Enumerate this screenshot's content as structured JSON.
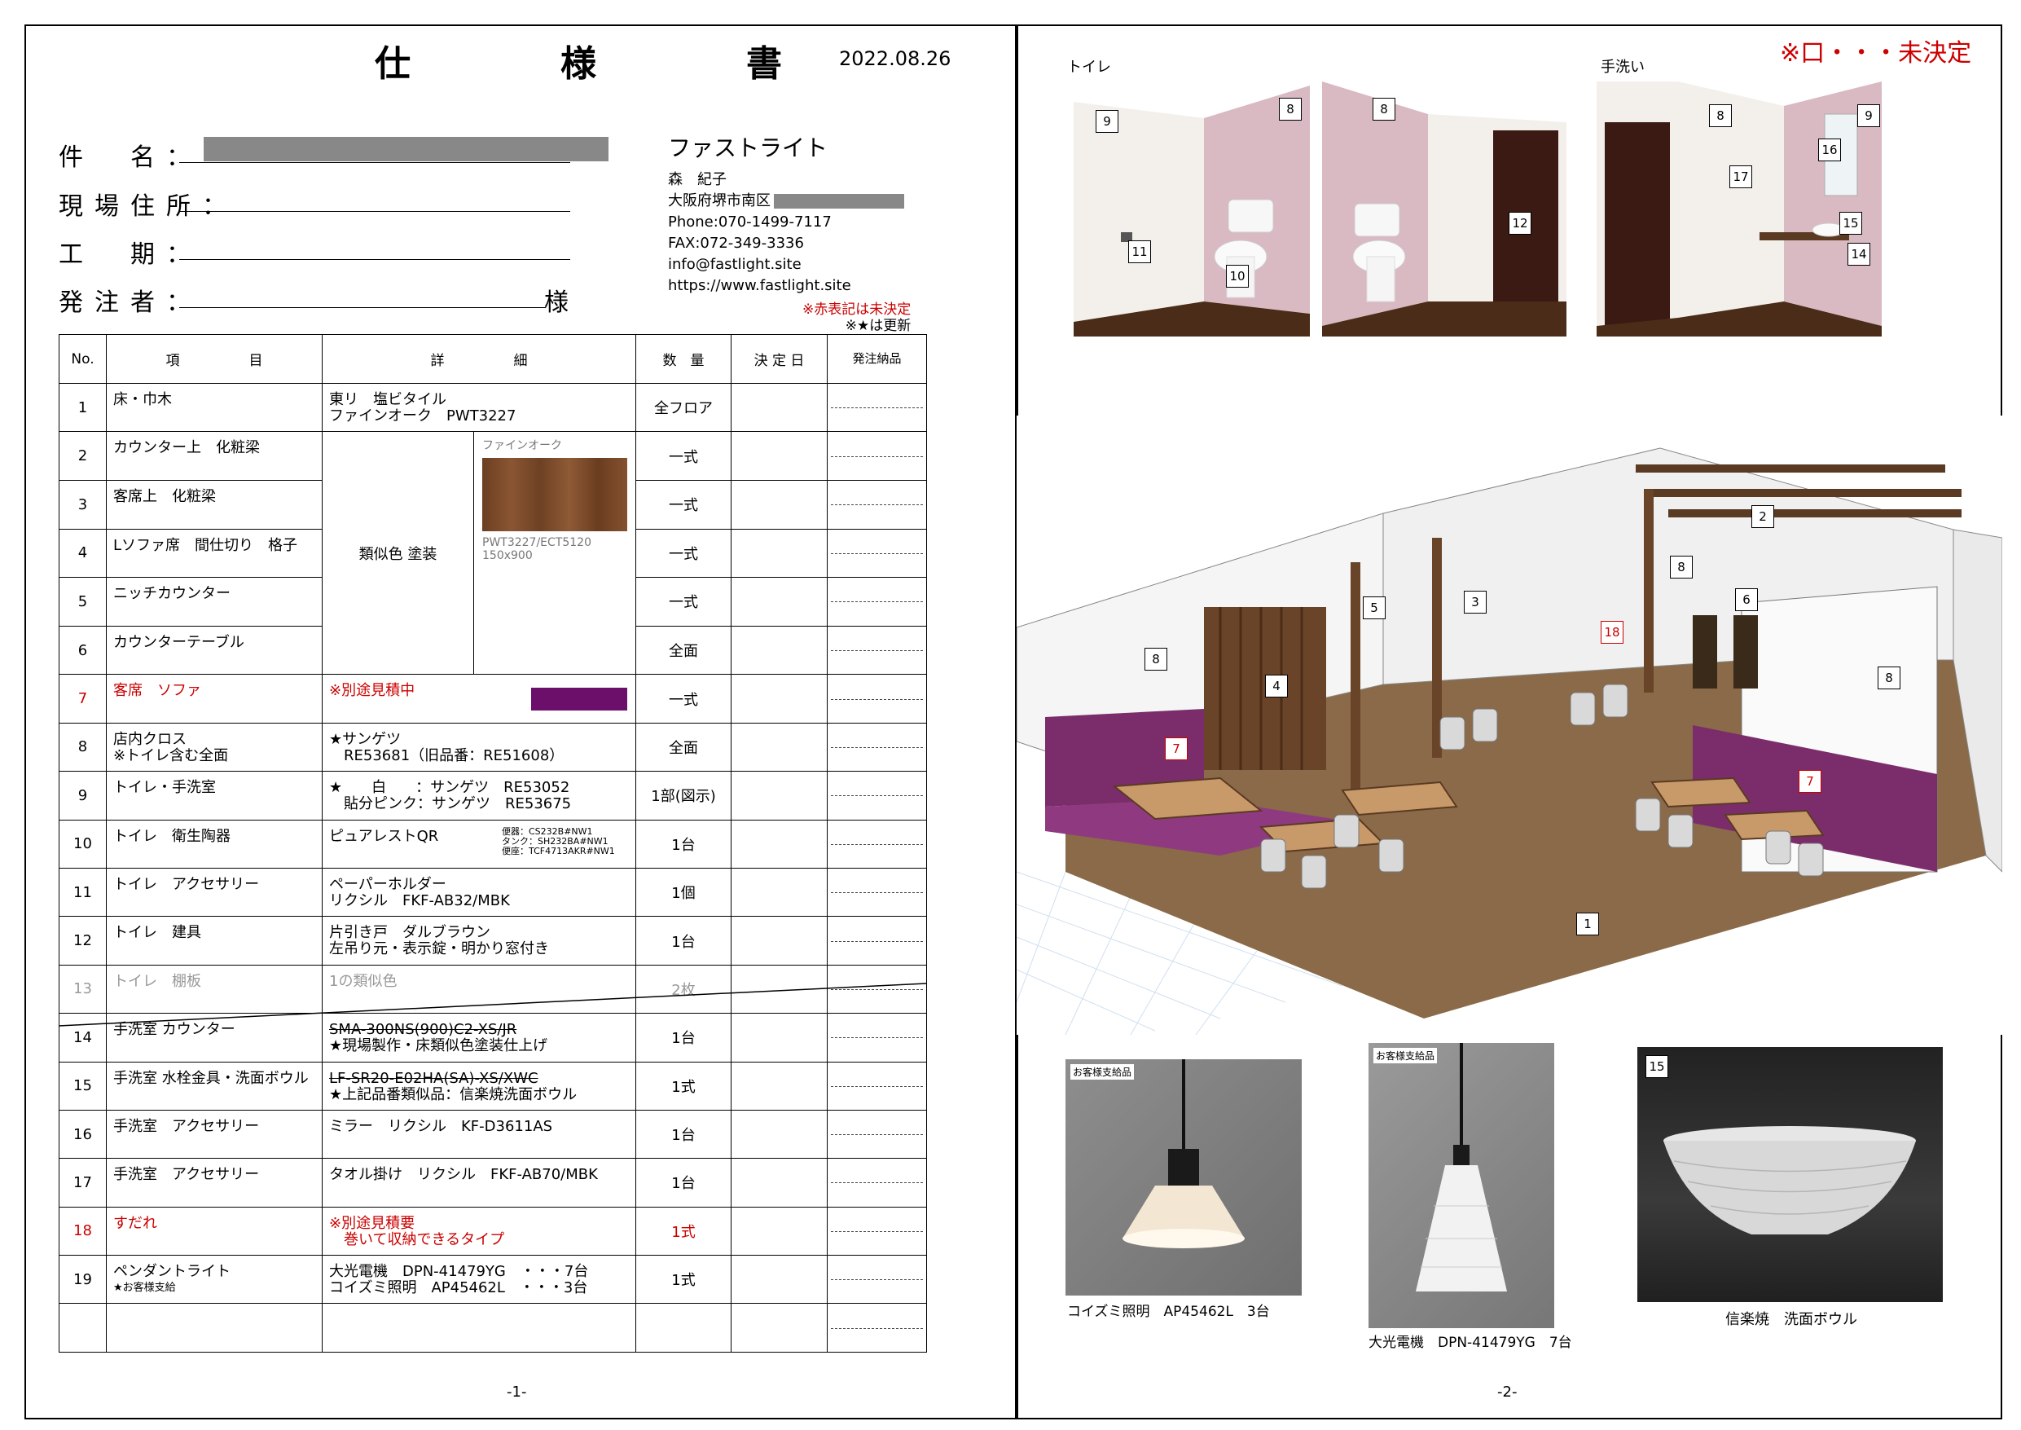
{
  "page1": {
    "title": "仕　様　書",
    "date": "2022.08.26",
    "fields": {
      "name_label": "件　名：",
      "site_label": "現場住所：",
      "period_label": "工　期：",
      "orderer_label": "発注者：",
      "orderer_suffix": "様"
    },
    "company": {
      "name": "ファストライト",
      "person": "森　紀子",
      "address": "大阪府堺市南区",
      "phone": "Phone:070-1499-7117",
      "fax": "FAX:072-349-3336",
      "email": "info@fastlight.site",
      "url": "https://www.fastlight.site"
    },
    "notes": {
      "red_note": "※赤表記は未決定",
      "star_note": "※★は更新"
    },
    "headers": {
      "no": "No.",
      "item": "項　　　　　目",
      "detail": "詳　　　　　細",
      "qty": "数　量",
      "decided": "決 定 日",
      "order": "発注納品"
    },
    "swatch": {
      "name": "ファインオーク",
      "code": "PWT3227/ECT5120",
      "size": "150x900",
      "merged_detail": "類似色 塗装"
    },
    "rows": [
      {
        "no": "1",
        "item": "床・巾木",
        "detail1": "東リ　塩ビタイル",
        "detail2": "ファインオーク　PWT3227",
        "qty": "全フロア"
      },
      {
        "no": "2",
        "item": "カウンター上　化粧梁",
        "qty": "一式"
      },
      {
        "no": "3",
        "item": "客席上　化粧梁",
        "qty": "一式"
      },
      {
        "no": "4",
        "item": "Lソファ席　間仕切り　格子",
        "qty": "一式"
      },
      {
        "no": "5",
        "item": "ニッチカウンター",
        "qty": "一式"
      },
      {
        "no": "6",
        "item": "カウンターテーブル",
        "qty": "全面"
      },
      {
        "no": "7",
        "item": "客席　ソファ",
        "detail1": "※別途見積中",
        "qty": "一式"
      },
      {
        "no": "8",
        "item": "店内クロス",
        "item2": "※トイレ含む全面",
        "detail1": "★サンゲツ",
        "detail2": "　RE53681（旧品番：RE51608）",
        "qty": "全面"
      },
      {
        "no": "9",
        "item": "トイレ・手洗室",
        "detail1": "★　　白　　：サンゲツ　RE53052",
        "detail2": "　貼分ピンク：サンゲツ　RE53675",
        "qty": "1部(図示)"
      },
      {
        "no": "10",
        "item": "トイレ　衛生陶器",
        "detail1": "ピュアレストQR",
        "sub1": "便器：CS232B#NW1",
        "sub2": "タンク：SH232BA#NW1",
        "sub3": "便座：TCF4713AKR#NW1",
        "qty": "1台"
      },
      {
        "no": "11",
        "item": "トイレ　アクセサリー",
        "detail1": "ペーパーホルダー",
        "detail2": "リクシル　FKF-AB32/MBK",
        "qty": "1個"
      },
      {
        "no": "12",
        "item": "トイレ　建具",
        "detail1": "片引き戸　ダルブラウン",
        "detail2": "左吊り元・表示錠・明かり窓付き",
        "qty": "1台"
      },
      {
        "no": "13",
        "item": "トイレ　棚板",
        "detail1": "1の類似色",
        "qty": "2枚"
      },
      {
        "no": "14",
        "item": "手洗室 カウンター",
        "detail1": "SMA-300NS(900)C2-XS/JR",
        "detail2": "★現場製作・床類似色塗装仕上げ",
        "qty": "1台"
      },
      {
        "no": "15",
        "item": "手洗室 水栓金具・洗面ボウル",
        "detail1": "LF-SR20-E02HA(SA)-XS/XWC",
        "detail2": "★上記品番類似品：信楽焼洗面ボウル",
        "qty": "1式"
      },
      {
        "no": "16",
        "item": "手洗室　アクセサリー",
        "detail1": "ミラー　リクシル　KF-D3611AS",
        "qty": "1台"
      },
      {
        "no": "17",
        "item": "手洗室　アクセサリー",
        "detail1": "タオル掛け　リクシル　FKF-AB70/MBK",
        "qty": "1台"
      },
      {
        "no": "18",
        "item": "すだれ",
        "detail1": "※別途見積要",
        "detail2": "　巻いて収納できるタイプ",
        "qty": "1式"
      },
      {
        "no": "19",
        "item": "ペンダントライト",
        "item2": "★お客様支給",
        "detail1": "大光電機　DPN-41479YG　・・・7台",
        "detail2": "コイズミ照明　AP45462L　・・・3台",
        "qty": "1式"
      }
    ],
    "page_number": "-1-"
  },
  "page2": {
    "undecided_note": "※口・・・未決定",
    "toilet_label": "トイレ",
    "washroom_label": "手洗い",
    "tags": {
      "t8": "8",
      "t9": "9",
      "t10": "10",
      "t11": "11",
      "t12": "12",
      "t14": "14",
      "t15": "15",
      "t16": "16",
      "t17": "17",
      "t1": "1",
      "t2": "2",
      "t3": "3",
      "t4": "4",
      "t5": "5",
      "t6": "6",
      "t7": "7",
      "t18": "18"
    },
    "photos": {
      "supplied": "お客様支給品",
      "lamp1": "コイズミ照明　AP45462L　3台",
      "lamp2": "大光電機　DPN-41479YG　7台",
      "bowl": "信楽焼　洗面ボウル",
      "bowl_tag": "15"
    },
    "page_number": "-2-",
    "colors": {
      "pink_wall": "#d9b9c2",
      "floor": "#5a3a22",
      "sofa": "#7b2d6b",
      "wood": "#7a5230",
      "accent_red": "#cc0000"
    }
  }
}
